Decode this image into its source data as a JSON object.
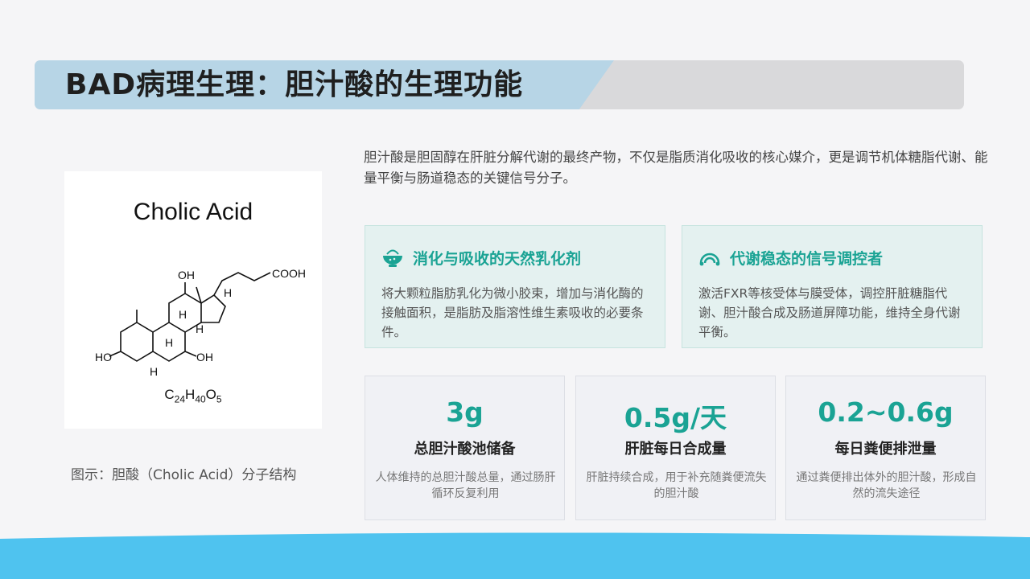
{
  "title": "BAD病理生理：胆汁酸的生理功能",
  "molecule": {
    "name": "Cholic Acid",
    "formula_parts": [
      "C",
      "24",
      "H",
      "40",
      "O",
      "5"
    ],
    "labels": {
      "oh_top": "OH",
      "cooh": "COOH",
      "h1": "H",
      "h2": "H",
      "h3": "H",
      "h4": "H",
      "h5": "H",
      "ho_left": "HO",
      "oh_right": "OH"
    }
  },
  "caption": "图示：胆酸（Cholic Acid）分子结构",
  "intro": "胆汁酸是胆固醇在肝脏分解代谢的最终产物，不仅是脂质消化吸收的核心媒介，更是调节机体糖脂代谢、能量平衡与肠道稳态的关键信号分子。",
  "features": [
    {
      "icon": "bowl-icon",
      "heading": "消化与吸收的天然乳化剂",
      "body": "将大颗粒脂肪乳化为微小胶束，增加与消化酶的接触面积，是脂肪及脂溶性维生素吸收的必要条件。"
    },
    {
      "icon": "signal-icon",
      "heading": "代谢稳态的信号调控者",
      "body": "激活FXR等核受体与膜受体，调控肝脏糖脂代谢、胆汁酸合成及肠道屏障功能，维持全身代谢平衡。"
    }
  ],
  "stats": [
    {
      "value": "3g",
      "label": "总胆汁酸池储备",
      "desc": "人体维持的总胆汁酸总量，通过肠肝循环反复利用"
    },
    {
      "value": "0.5g/天",
      "label": "肝脏每日合成量",
      "desc": "肝脏持续合成，用于补充随粪便流失的胆汁酸"
    },
    {
      "value": "0.2~0.6g",
      "label": "每日粪便排泄量",
      "desc": "通过粪便排出体外的胆汁酸，形成自然的流失途径"
    }
  ],
  "colors": {
    "accent": "#1aa394",
    "title_band": "#b7d5e6",
    "footer_wave": "#4fc3ef"
  }
}
